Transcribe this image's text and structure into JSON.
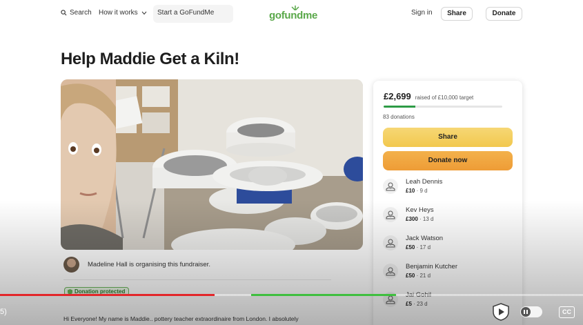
{
  "header": {
    "search_label": "Search",
    "how_label": "How it works",
    "start_label": "Start a GoFundMe",
    "logo_text": "gofundme",
    "signin_label": "Sign in",
    "share_label": "Share",
    "donate_label": "Donate"
  },
  "campaign": {
    "title": "Help Maddie Get a Kiln!",
    "organiser": "Madeline Hall is organising this fundraiser.",
    "protected_label": "Donation protected",
    "description": "Hi Everyone! My name is Maddie.. pottery teacher extraordinaire from London. I absolutely"
  },
  "card": {
    "raised_amount": "£2,699",
    "raised_sub": "raised of £10,000 target",
    "progress_fraction": 0.27,
    "donations_count": "83 donations",
    "share_button": "Share",
    "donate_button": "Donate now",
    "donors": [
      {
        "name": "Leah Dennis",
        "amount": "£10",
        "time": "9 d"
      },
      {
        "name": "Kev Heys",
        "amount": "£300",
        "time": "13 d"
      },
      {
        "name": "Jack Watson",
        "amount": "£50",
        "time": "17 d"
      },
      {
        "name": "Benjamin Kutcher",
        "amount": "£50",
        "time": "21 d"
      },
      {
        "name": "Jai Gohil",
        "amount": "£5",
        "time": "23 d"
      }
    ]
  },
  "player": {
    "time_fragment": "5)",
    "cc_label": "CC",
    "played_fraction": 0.368
  },
  "colors": {
    "brand_green": "#5aa84a",
    "share_yellow": "#f2c84e",
    "donate_orange": "#ee9c36",
    "progress_green": "#2d9b45",
    "played_red": "#e3262a"
  }
}
